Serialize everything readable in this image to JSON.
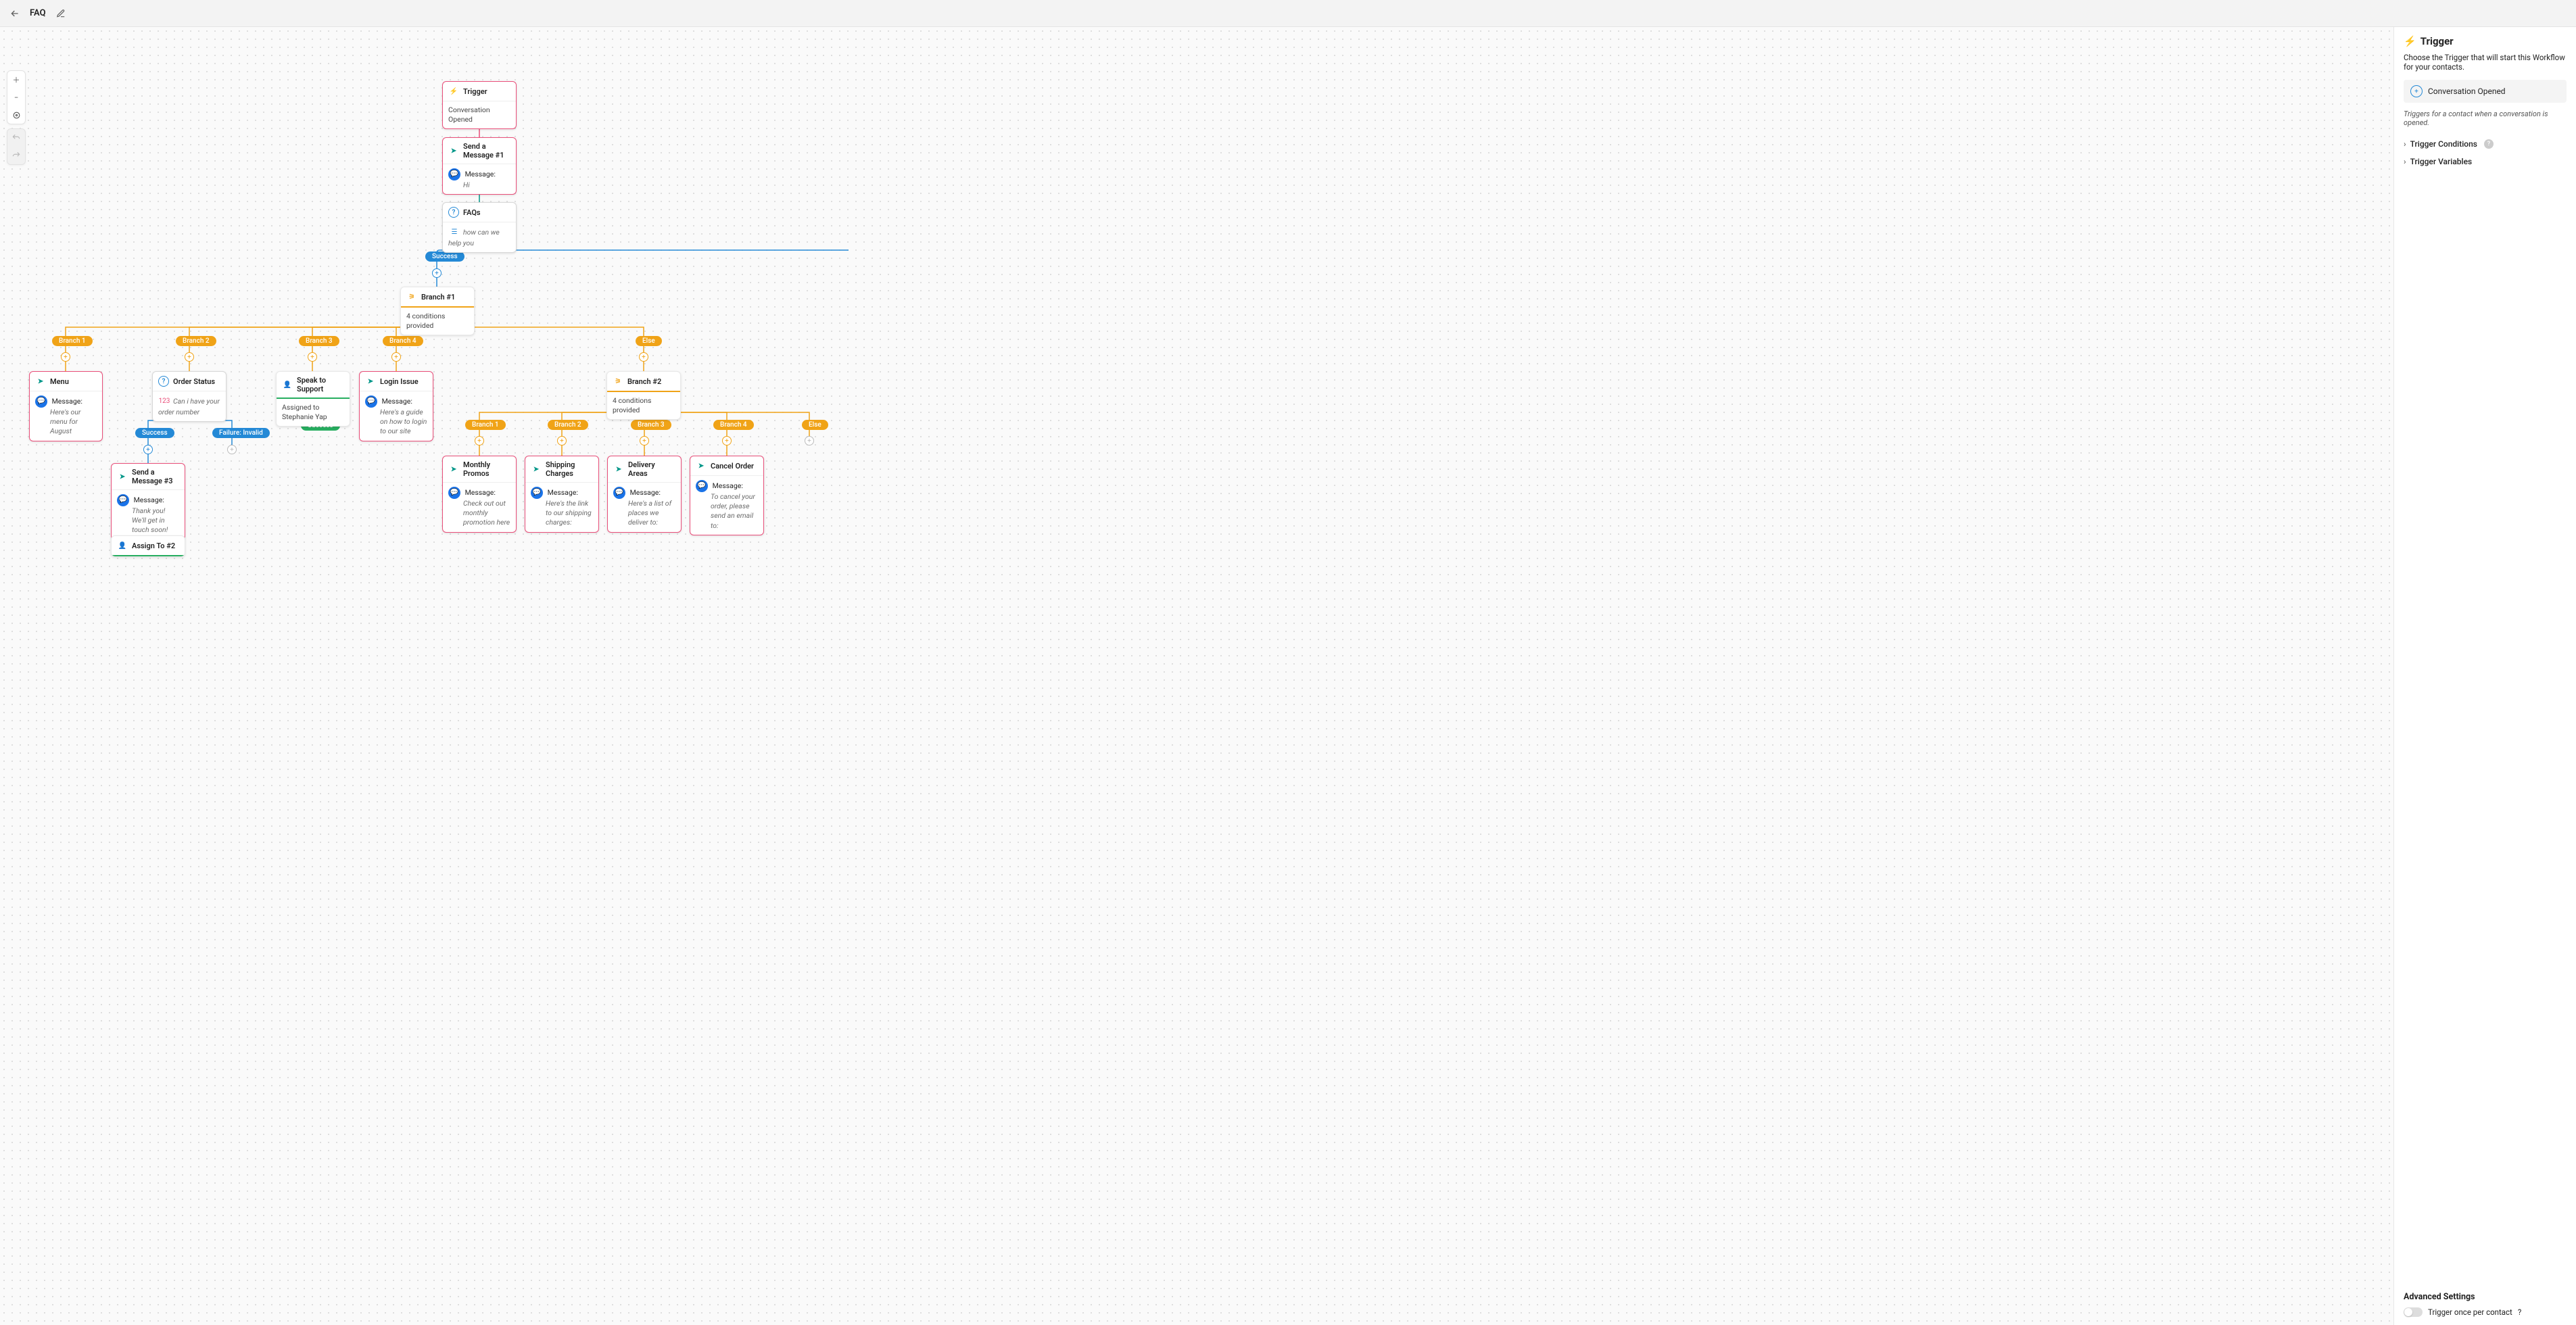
{
  "topbar": {
    "title": "FAQ"
  },
  "panel": {
    "title": "Trigger",
    "desc": "Choose the Trigger that will start this Workflow for your contacts.",
    "selected_trigger": "Conversation Opened",
    "hint": "Triggers for a contact when a conversation is opened.",
    "cond_label": "Trigger Conditions",
    "vars_label": "Trigger Variables",
    "advanced_title": "Advanced Settings",
    "toggle_label": "Trigger once per contact"
  },
  "nodes": {
    "trigger": {
      "title": "Trigger",
      "body": "Conversation Opened"
    },
    "send1": {
      "title": "Send a Message #1",
      "msg_label": "Message:",
      "msg": "Hi"
    },
    "faqs": {
      "title": "FAQs",
      "body": "how can we help you"
    },
    "branch1": {
      "title": "Branch #1",
      "body": "4 conditions provided"
    },
    "menu": {
      "title": "Menu",
      "msg_label": "Message:",
      "msg": "Here's our menu for August"
    },
    "order_status": {
      "title": "Order Status",
      "body": "Can i have your order number"
    },
    "speak_support": {
      "title": "Speak to Support",
      "body": "Assigned to Stephanie Yap"
    },
    "login_issue": {
      "title": "Login Issue",
      "msg_label": "Message:",
      "msg": "Here's a guide on how to login to our site"
    },
    "branch2": {
      "title": "Branch #2",
      "body": "4 conditions provided"
    },
    "send3": {
      "title": "Send a Message #3",
      "msg_label": "Message:",
      "msg": "Thank you! We'll get in touch soon!"
    },
    "assign2": {
      "title": "Assign To #2"
    },
    "monthly_promos": {
      "title": "Monthly Promos",
      "msg_label": "Message:",
      "msg": "Check out out monthly promotion here"
    },
    "shipping": {
      "title": "Shipping Charges",
      "msg_label": "Message:",
      "msg": "Here's the link to our shipping charges:"
    },
    "delivery_areas": {
      "title": "Delivery Areas",
      "msg_label": "Message:",
      "msg": "Here's a list of places we deliver to:"
    },
    "cancel_order": {
      "title": "Cancel Order",
      "msg_label": "Message:",
      "msg": "To cancel your order, please send an email to:"
    }
  },
  "chips": {
    "faq_success": "Success",
    "b1": "Branch 1",
    "b2": "Branch 2",
    "b3": "Branch 3",
    "b4": "Branch 4",
    "else": "Else",
    "os_success": "Success",
    "os_failure": "Failure: Invalid",
    "sp_success": "Success",
    "sb1": "Branch 1",
    "sb2": "Branch 2",
    "sb3": "Branch 3",
    "sb4": "Branch 4",
    "selse": "Else"
  }
}
